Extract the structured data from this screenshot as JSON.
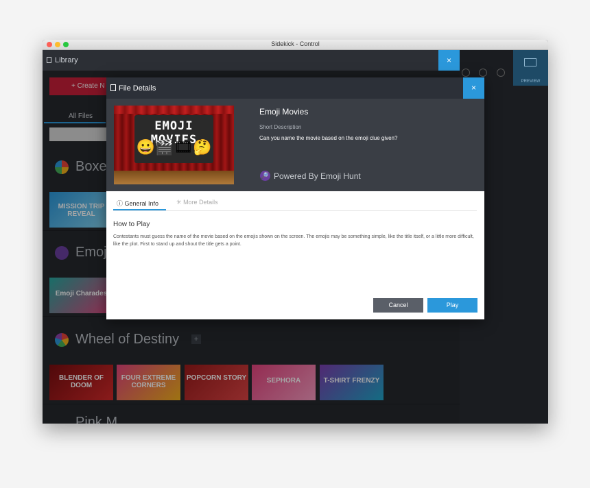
{
  "window": {
    "title": "Sidekick - Control"
  },
  "library": {
    "title": "Library",
    "close_label": "×",
    "create_label": "+ Create N",
    "all_files_label": "All Files"
  },
  "preview": {
    "label": "PREVIEW"
  },
  "sections": [
    {
      "title": "Boxe",
      "thumbs": [
        "MISSION TRIP REVEAL"
      ]
    },
    {
      "title": "Emoj",
      "thumbs": [
        "Emoji Charades"
      ]
    },
    {
      "title": "Wheel of Destiny",
      "add_label": "+",
      "thumbs": [
        "BLENDER OF DOOM",
        "FOUR EXTREME CORNERS",
        "POPCORN STORY",
        "SEPHORA",
        "T-SHIRT FRENZY"
      ]
    },
    {
      "title": "Pink M"
    }
  ],
  "modal": {
    "title": "File Details",
    "close_label": "×",
    "poster_title": "EMOJI MOVIES",
    "poster_emojis": "😀🎬🎞🤔",
    "game_name": "Emoji Movies",
    "short_desc_label": "Short Description",
    "short_desc": "Can you name the movie based on the emoji clue given?",
    "powered_by": "Powered By Emoji Hunt",
    "tabs": [
      {
        "label": "General Info"
      },
      {
        "label": "More Details"
      }
    ],
    "howto_title": "How to Play",
    "howto_text": "Contestants must guess the name of the movie based on the emojis shown on the screen. The emojis may be something simple, like the title itself, or a little more difficult, like the plot. First to stand up and shout the title gets a point.",
    "cancel_label": "Cancel",
    "play_label": "Play"
  },
  "colors": {
    "accent": "#2b98db",
    "create": "#c8203a",
    "header": "#2c3038"
  }
}
